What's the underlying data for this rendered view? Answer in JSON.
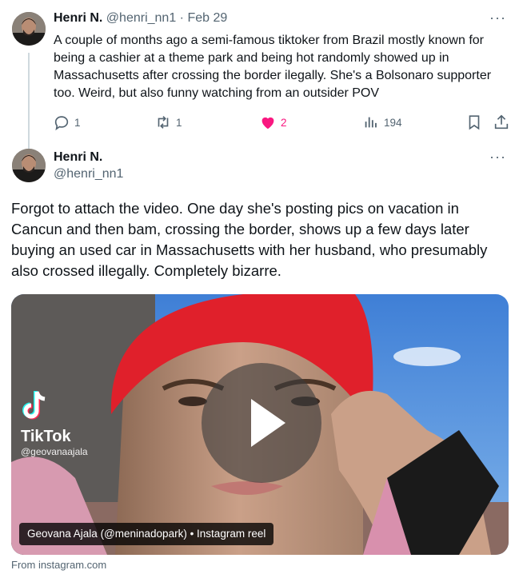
{
  "tweet1": {
    "name": "Henri N.",
    "handle": "@henri_nn1",
    "separator": "·",
    "date": "Feb 29",
    "text": "A couple of months ago a semi-famous tiktoker from Brazil mostly known for being a cashier at a theme park and being hot randomly showed up in Massachusetts after crossing the border ilegally. She's a Bolsonaro supporter too. Weird, but also funny watching from an outsider POV",
    "more": "···",
    "actions": {
      "replies": "1",
      "reposts": "1",
      "likes": "2",
      "views": "194"
    }
  },
  "tweet2": {
    "name": "Henri N.",
    "handle": "@henri_nn1",
    "more": "···",
    "text": "Forgot to attach the video. One day she's posting pics on vacation in Cancun and then bam, crossing the border, shows up a few days later buying an used car in Massachusetts with her husband, who presumably also crossed illegally. Completely bizarre.",
    "media": {
      "brand": "TikTok",
      "brand_handle": "@geovanaajala",
      "caption": "Geovana Ajala (@meninadopark) • Instagram reel"
    },
    "source": "From instagram.com"
  },
  "colors": {
    "like": "#f91880",
    "muted": "#536471",
    "text": "#0f1419",
    "thread_line": "#cfd9de"
  },
  "icons": [
    "reply-icon",
    "repost-icon",
    "heart-icon",
    "views-icon",
    "bookmark-icon",
    "share-icon",
    "play-icon",
    "tiktok-logo-icon"
  ]
}
